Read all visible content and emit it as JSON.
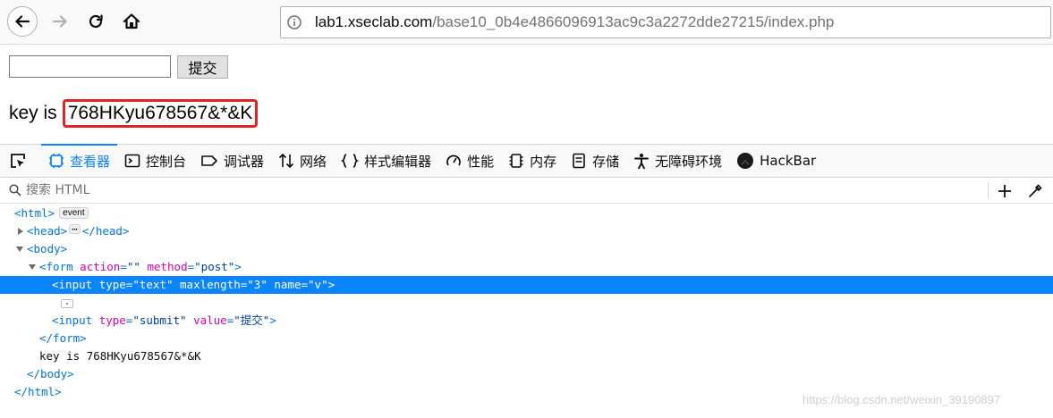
{
  "browser": {
    "url_host": "lab1.xseclab.com",
    "url_path": "/base10_0b4e4866096913ac9c3a2272dde27215/index.php"
  },
  "page": {
    "submit_label": "提交",
    "key_prefix": "key is",
    "key_value": "768HKyu678567&*&K"
  },
  "devtools": {
    "tabs": [
      {
        "label": "查看器",
        "icon": "inspector-icon",
        "active": true
      },
      {
        "label": "控制台",
        "icon": "console-icon"
      },
      {
        "label": "调试器",
        "icon": "debugger-icon"
      },
      {
        "label": "网络",
        "icon": "network-icon"
      },
      {
        "label": "样式编辑器",
        "icon": "style-editor-icon"
      },
      {
        "label": "性能",
        "icon": "performance-icon"
      },
      {
        "label": "内存",
        "icon": "memory-icon"
      },
      {
        "label": "存储",
        "icon": "storage-icon"
      },
      {
        "label": "无障碍环境",
        "icon": "accessibility-icon"
      },
      {
        "label": "HackBar",
        "icon": "hackbar-icon"
      }
    ],
    "search_placeholder": "搜索 HTML",
    "tree": {
      "html_open": "<html>",
      "event_badge": "event",
      "head_open": "<head>",
      "head_close": "</head>",
      "body_open": "<body>",
      "form_tag": "<form",
      "form_attr1_name": "action",
      "form_attr1_value": "\"\"",
      "form_attr2_name": "method",
      "form_attr2_value": "\"post\"",
      "input1_tag": "<input",
      "input1_attr1_name": "type",
      "input1_attr1_value": "\"text\"",
      "input1_attr2_name": "maxlength",
      "input1_attr2_value": "\"3\"",
      "input1_attr3_name": "name",
      "input1_attr3_value": "\"v\"",
      "input2_tag": "<input",
      "input2_attr1_name": "type",
      "input2_attr1_value": "\"submit\"",
      "input2_attr2_name": "value",
      "input2_attr2_value": "\"提交\"",
      "form_close": "</form>",
      "text_node": "key is 768HKyu678567&*&K",
      "body_close": "</body>",
      "html_close": "</html>"
    }
  },
  "watermark": "https://blog.csdn.net/weixin_39190897",
  "colors": {
    "accent": "#0a84ff",
    "highlight_box": "#e02424",
    "tag": "#0074e8",
    "attr_name": "#dd00a9",
    "attr_value": "#003eaa"
  }
}
